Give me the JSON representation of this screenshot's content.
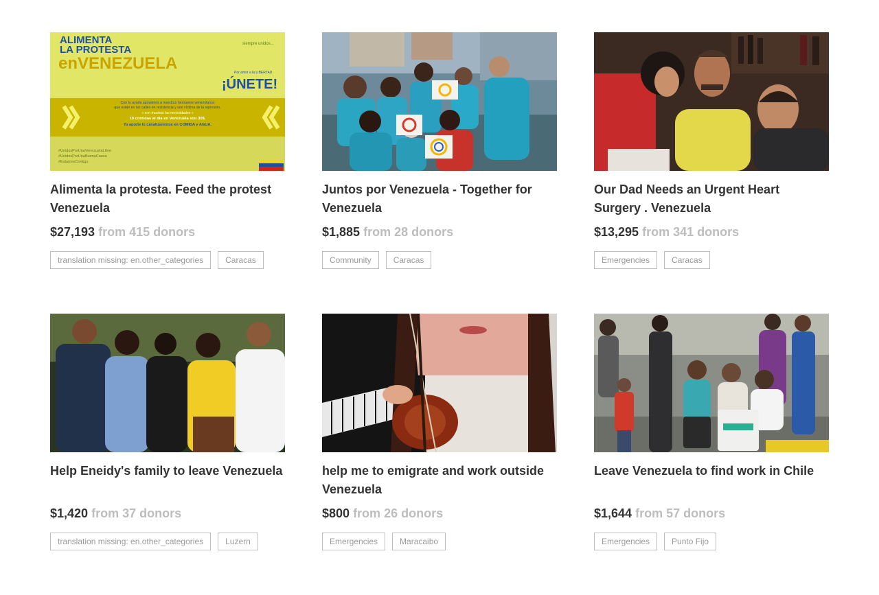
{
  "campaigns": [
    {
      "title": "Alimenta la protesta. Feed the protest Venezuela",
      "amount": "$27,193",
      "donors": "from 415 donors",
      "tags": [
        "translation missing: en.other_categories",
        "Caracas"
      ],
      "banner": {
        "line1": "ALIMENTA",
        "line2": "LA PROTESTA",
        "line3": "enVENEZUELA",
        "small_top": "siempre unidos...",
        "cta_small": "Por amor a la LIBERTAD",
        "cta": "¡ÚNETE!",
        "body1": "Con tu ayuda apoyamos a nuestros hermanos venezolanos",
        "body2": "que están en las calles en resistencia y son víctima de la represión.",
        "body3": "« son muchas las necesidades »",
        "body4": "10 comidas al día en Venezuela son 30$.",
        "body5": "Tu aporte lo canalizaremos en COMIDA y AGUA.",
        "hash1": "#UnidosPorUnaVenezuelaLibre",
        "hash2": "#UnidosPorUnaBuenaCausa",
        "hash3": "#EstamosContigo"
      }
    },
    {
      "title": "Juntos por Venezuela - Together for Venezuela",
      "amount": "$1,885",
      "donors": "from 28 donors",
      "tags": [
        "Community",
        "Caracas"
      ]
    },
    {
      "title": "Our Dad Needs an Urgent Heart Surgery . Venezuela",
      "amount": "$13,295",
      "donors": "from 341 donors",
      "tags": [
        "Emergencies",
        "Caracas"
      ]
    },
    {
      "title": "Help Eneidy's family to leave Venezuela",
      "amount": "$1,420",
      "donors": "from 37 donors",
      "tags": [
        "translation missing: en.other_categories",
        "Luzern"
      ]
    },
    {
      "title": "help me to emigrate and work outside Venezuela",
      "amount": "$800",
      "donors": "from 26 donors",
      "tags": [
        "Emergencies",
        "Maracaibo"
      ]
    },
    {
      "title": "Leave Venezuela to find work in Chile",
      "amount": "$1,644",
      "donors": "from 57 donors",
      "tags": [
        "Emergencies",
        "Punto Fijo"
      ]
    }
  ],
  "colors": {
    "text": "#333333",
    "muted": "#bdbdbd",
    "tag_border": "#bdbdbd",
    "banner_yellow": "#e6e86a",
    "banner_band": "#c9b800",
    "banner_blue": "#1f4fa0"
  }
}
